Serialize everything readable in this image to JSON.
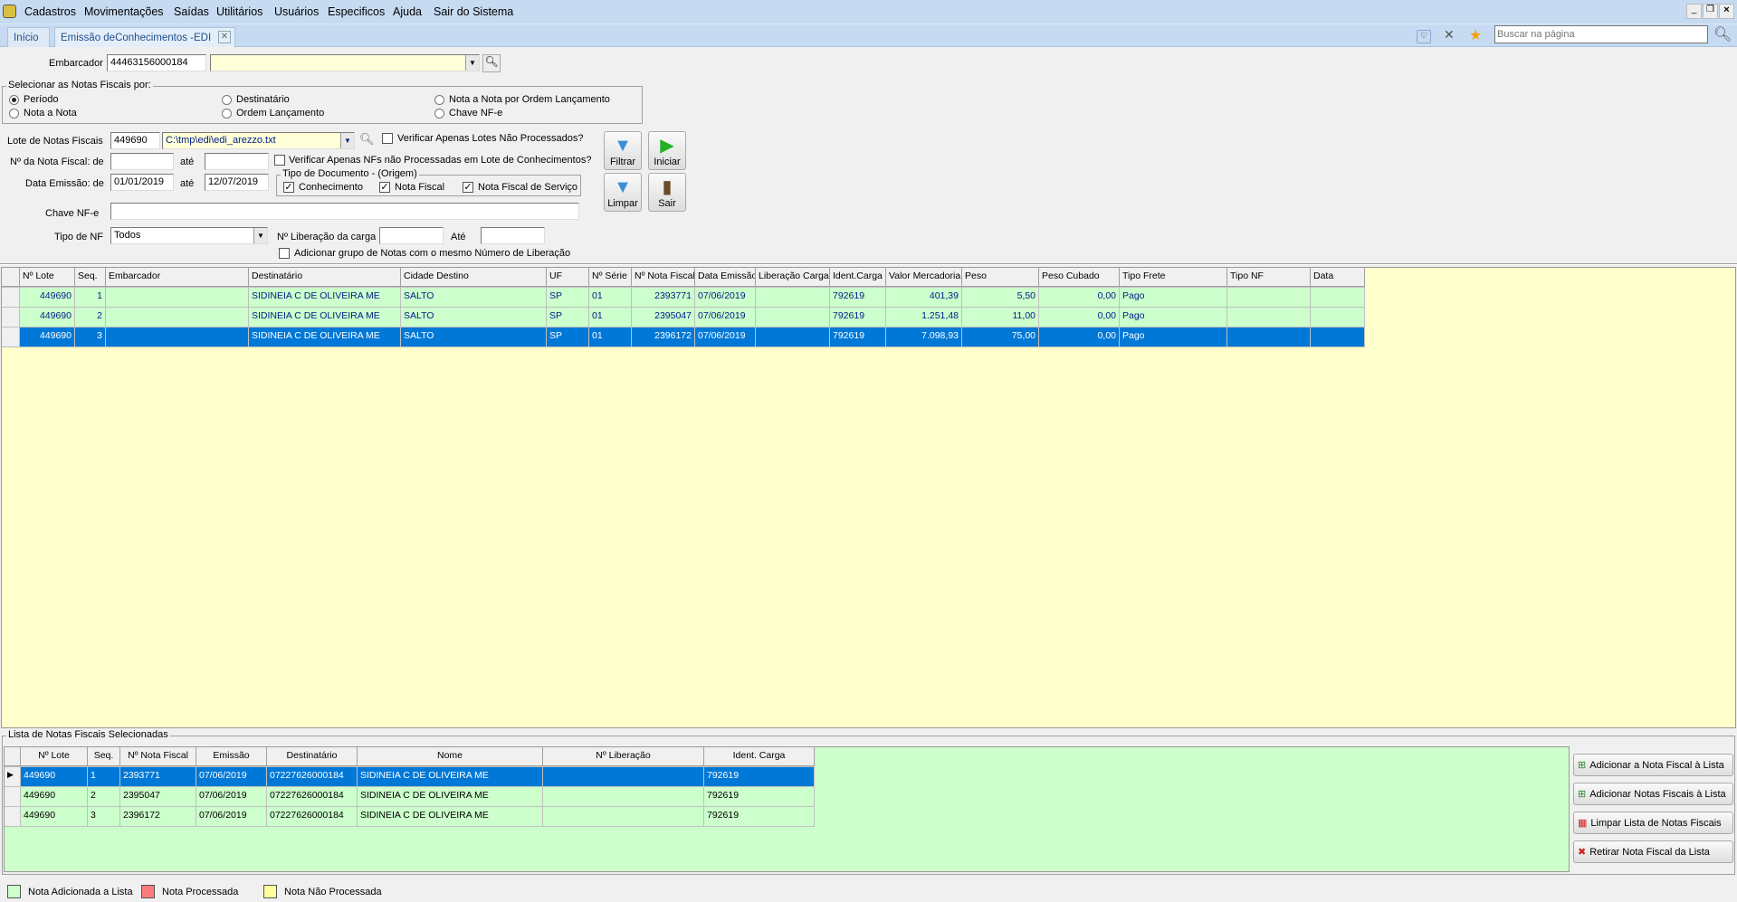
{
  "menu": [
    "Cadastros",
    "Movimentações",
    "Saídas",
    "Utilitários",
    "Usuários",
    "Especificos",
    "Ajuda",
    "Sair do Sistema"
  ],
  "tabs": [
    {
      "label": "Início"
    },
    {
      "label": "Emissão deConhecimentos -EDI"
    }
  ],
  "search": {
    "placeholder": "Buscar na página"
  },
  "form": {
    "embarcador_label": "Embarcador",
    "embarcador_value": "44463156000184",
    "embarcador_name": "",
    "select_group": "Selecionar as Notas Fiscais por:",
    "radios": [
      {
        "label": "Período",
        "on": true
      },
      {
        "label": "Nota a Nota",
        "on": false
      },
      {
        "label": "Destinatário",
        "on": false
      },
      {
        "label": "Ordem Lançamento",
        "on": false
      },
      {
        "label": "Nota a Nota por Ordem Lançamento",
        "on": false
      },
      {
        "label": "Chave NF-e",
        "on": false
      }
    ],
    "lote_label": "Lote de Notas Fiscais",
    "lote_value": "449690",
    "lote_file": "C:\\tmp\\edi\\edi_arezzo.txt",
    "chk_lotes": "Verificar Apenas Lotes Não Processados?",
    "nf_label": "Nº da Nota Fiscal: de",
    "ate": "até",
    "nf_from": "",
    "nf_to": "",
    "chk_nfs": "Verificar Apenas NFs não Processadas em Lote de Conhecimentos?",
    "data_label": "Data Emissão: de",
    "data_from": "01/01/2019",
    "data_to": "12/07/2019",
    "tipo_doc_group": "Tipo de Documento - (Origem)",
    "tipo_doc": [
      {
        "label": "Conhecimento",
        "checked": true
      },
      {
        "label": "Nota Fiscal",
        "checked": true
      },
      {
        "label": "Nota Fiscal de Serviço",
        "checked": true
      }
    ],
    "chave_label": "Chave NF-e",
    "chave_value": "",
    "tipo_nf_label": "Tipo de NF",
    "tipo_nf_value": "Todos",
    "lib_label": "Nº Liberação da carga",
    "lib_ate": "Até",
    "chk_grupo": "Adicionar grupo de Notas com o mesmo Número de Liberação"
  },
  "buttons": {
    "filtrar": "Filtrar",
    "iniciar": "Iniciar",
    "limpar": "Limpar",
    "sair": "Sair"
  },
  "grid": {
    "columns": [
      "Nº Lote",
      "Seq.",
      "Embarcador",
      "Destinatário",
      "Cidade Destino",
      "UF",
      "Nº Série",
      "Nº Nota Fiscal",
      "Data Emissão",
      "Liberação Carga",
      "Ident.Carga",
      "Valor Mercadoria",
      "Peso",
      "Peso  Cubado",
      "Tipo Frete",
      "Tipo NF",
      "Data"
    ],
    "rows": [
      [
        "449690",
        "1",
        "",
        "SIDINEIA C DE OLIVEIRA ME",
        "SALTO",
        "SP",
        "01",
        "2393771",
        "07/06/2019",
        "",
        "792619",
        "401,39",
        "5,50",
        "0,00",
        "Pago",
        "",
        ""
      ],
      [
        "449690",
        "2",
        "",
        "SIDINEIA C DE OLIVEIRA ME",
        "SALTO",
        "SP",
        "01",
        "2395047",
        "07/06/2019",
        "",
        "792619",
        "1.251,48",
        "11,00",
        "0,00",
        "Pago",
        "",
        ""
      ],
      [
        "449690",
        "3",
        "",
        "SIDINEIA C DE OLIVEIRA ME",
        "SALTO",
        "SP",
        "01",
        "2396172",
        "07/06/2019",
        "",
        "792619",
        "7.098,93",
        "75,00",
        "0,00",
        "Pago",
        "",
        ""
      ]
    ],
    "selected": 2
  },
  "list": {
    "title": "Lista de Notas Fiscais Selecionadas",
    "columns": [
      "Nº Lote",
      "Seq.",
      "Nº Nota Fiscal",
      "Emissão",
      "Destinatário",
      "Nome",
      "Nº Liberação",
      "Ident. Carga"
    ],
    "rows": [
      [
        "449690",
        "1",
        "2393771",
        "07/06/2019",
        "07227626000184",
        "SIDINEIA C DE OLIVEIRA ME",
        "",
        "792619"
      ],
      [
        "449690",
        "2",
        "2395047",
        "07/06/2019",
        "07227626000184",
        "SIDINEIA C DE OLIVEIRA ME",
        "",
        "792619"
      ],
      [
        "449690",
        "3",
        "2396172",
        "07/06/2019",
        "07227626000184",
        "SIDINEIA C DE OLIVEIRA ME",
        "",
        "792619"
      ]
    ],
    "selected": 0,
    "actions": [
      "Adicionar a Nota Fiscal à Lista",
      "Adicionar Notas Fiscais à Lista",
      "Limpar Lista de Notas Fiscais",
      "Retirar Nota Fiscal da Lista"
    ]
  },
  "legend": [
    {
      "label": "Nota Adicionada a Lista",
      "color": "#ccffcc"
    },
    {
      "label": "Nota Processada",
      "color": "#ff7b7b"
    },
    {
      "label": "Nota Não Processada",
      "color": "#ffff9e"
    }
  ],
  "colors": {
    "selected": "#0078d7",
    "green": "#ccffcc",
    "yellow": "#ffffcc"
  }
}
